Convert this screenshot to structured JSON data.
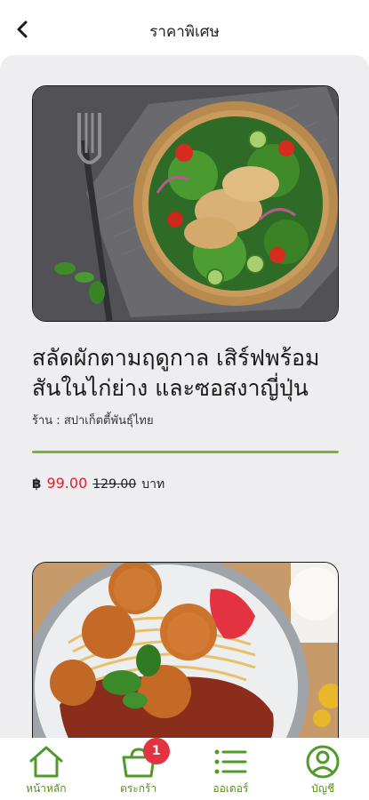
{
  "header": {
    "title": "ราคาพิเศษ"
  },
  "products": [
    {
      "name": "สลัดผักตามฤดูกาล เสิร์ฟพร้อมสันในไก่ย่าง และซอสงาญี่ปุ่น",
      "shop": "ร้าน : สปาเก็ตตี้พันธุ์ไทย",
      "currency": "฿",
      "price": "99.00",
      "old_price": "129.00",
      "unit": "บาท"
    },
    {
      "name": "",
      "shop": "",
      "currency": "",
      "price": "",
      "old_price": "",
      "unit": ""
    }
  ],
  "nav": {
    "home": "หน้าหลัก",
    "cart": "ตระกร้า",
    "cart_badge": "1",
    "orders": "ออเดอร์",
    "account": "บัญชี"
  },
  "colors": {
    "accent": "#79b531",
    "nav_icon": "#4f9a2a",
    "price": "#e0202f",
    "badge": "#e33240",
    "background": "#eeedef"
  }
}
